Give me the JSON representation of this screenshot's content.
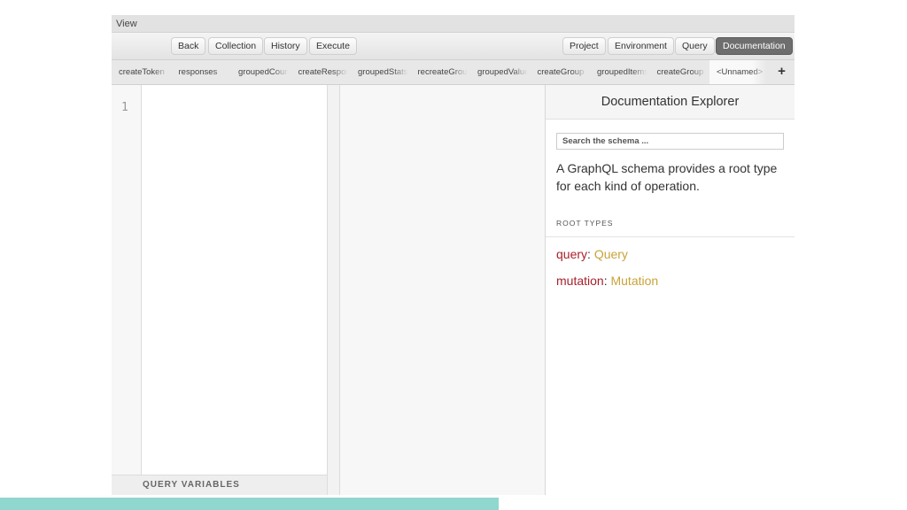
{
  "menu": {
    "view_label": "View"
  },
  "toolbar": {
    "back": "Back",
    "collection": "Collection",
    "history": "History",
    "execute": "Execute",
    "project": "Project",
    "environment": "Environment",
    "query": "Query",
    "documentation": "Documentation"
  },
  "tabs": [
    {
      "label": "createToken"
    },
    {
      "label": "responses"
    },
    {
      "label": "groupedCount"
    },
    {
      "label": "createResponse"
    },
    {
      "label": "groupedStats"
    },
    {
      "label": "recreateGroup"
    },
    {
      "label": "groupedValues"
    },
    {
      "label": "createGroup"
    },
    {
      "label": "groupedItems"
    },
    {
      "label": "createGroup"
    },
    {
      "label": "<Unnamed>"
    }
  ],
  "tab_add_icon": "+",
  "editor": {
    "line_number": "1",
    "query_variables_label": "QUERY VARIABLES"
  },
  "docs": {
    "title": "Documentation Explorer",
    "search_placeholder": "Search the schema ...",
    "description": "A GraphQL schema provides a root type for each kind of operation.",
    "root_types_title": "ROOT TYPES",
    "fields": [
      {
        "name": "query",
        "type": "Query"
      },
      {
        "name": "mutation",
        "type": "Mutation"
      }
    ]
  },
  "colors": {
    "field_name": "#a8202b",
    "field_type": "#c8a33a",
    "active_button": "#6e6e6e",
    "bottom_bar": "#8fd7cf"
  }
}
